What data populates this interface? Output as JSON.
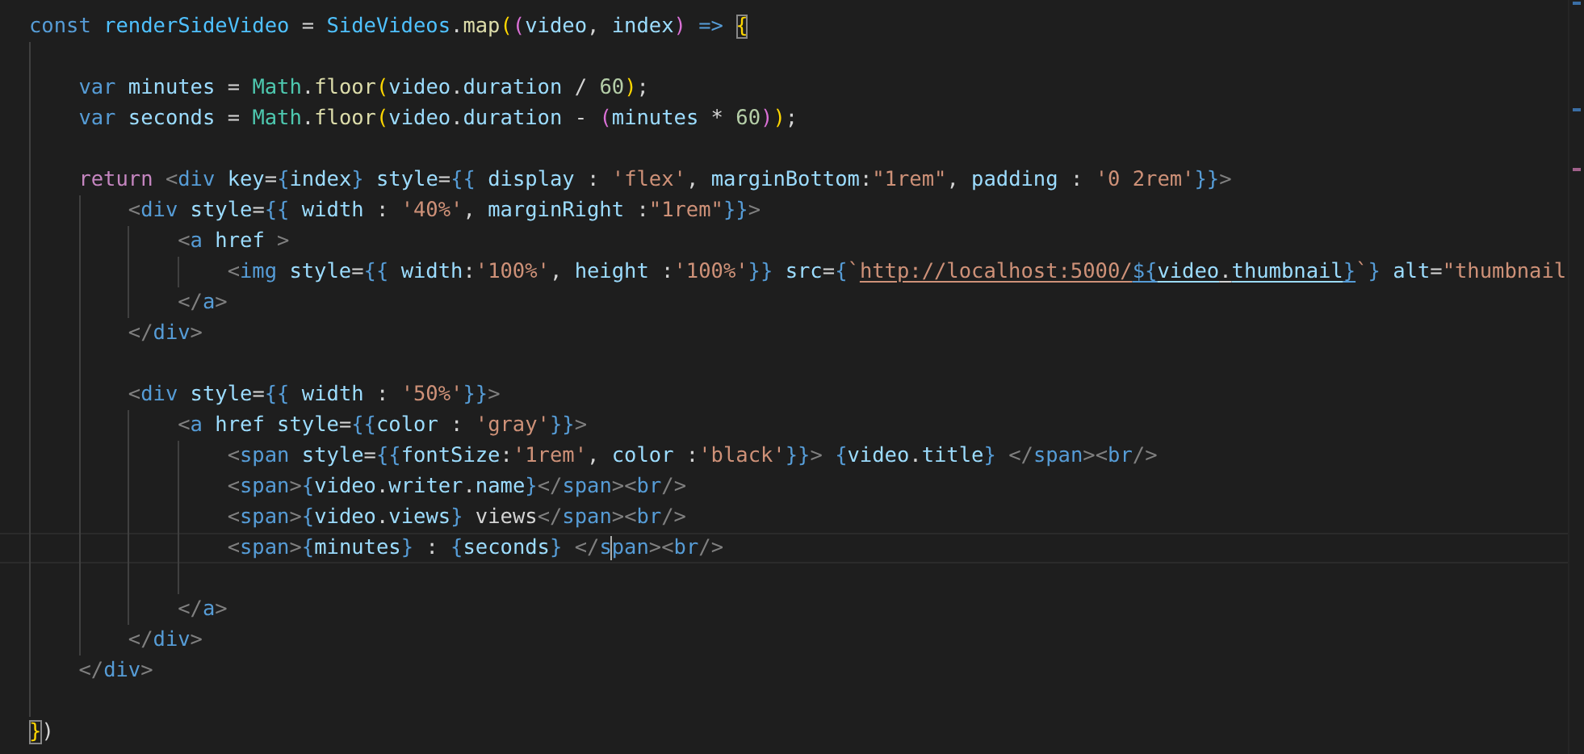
{
  "editor": {
    "lines": [
      {
        "current": false,
        "tokens": [
          {
            "text": "const",
            "kind": "keyword"
          },
          {
            "text": " renderSideVideo",
            "kind": "constant"
          },
          {
            "text": " = ",
            "kind": "plain"
          },
          {
            "text": "SideVideos",
            "kind": "constant"
          },
          {
            "text": ".",
            "kind": "plain"
          },
          {
            "text": "map",
            "kind": "function"
          },
          {
            "text": "(",
            "kind": "bracket1"
          },
          {
            "text": "(",
            "kind": "bracket2"
          },
          {
            "text": "video",
            "kind": "variable"
          },
          {
            "text": ", ",
            "kind": "plain"
          },
          {
            "text": "index",
            "kind": "variable"
          },
          {
            "text": ")",
            "kind": "bracket2"
          },
          {
            "text": " => ",
            "kind": "keyword"
          },
          {
            "text": "{",
            "kind": "bracket1",
            "matched": true
          }
        ]
      },
      {
        "current": false
      },
      {
        "current": false,
        "tokens": [
          {
            "text": "    var",
            "kind": "keyword"
          },
          {
            "text": " minutes",
            "kind": "variable"
          },
          {
            "text": " = ",
            "kind": "plain"
          },
          {
            "text": "Math",
            "kind": "class"
          },
          {
            "text": ".",
            "kind": "plain"
          },
          {
            "text": "floor",
            "kind": "function"
          },
          {
            "text": "(",
            "kind": "bracket1"
          },
          {
            "text": "video",
            "kind": "variable"
          },
          {
            "text": ".",
            "kind": "plain"
          },
          {
            "text": "duration",
            "kind": "variable"
          },
          {
            "text": " / ",
            "kind": "plain"
          },
          {
            "text": "60",
            "kind": "number"
          },
          {
            "text": ")",
            "kind": "bracket1"
          },
          {
            "text": ";",
            "kind": "plain"
          }
        ]
      },
      {
        "current": false,
        "tokens": [
          {
            "text": "    var",
            "kind": "keyword"
          },
          {
            "text": " seconds",
            "kind": "variable"
          },
          {
            "text": " = ",
            "kind": "plain"
          },
          {
            "text": "Math",
            "kind": "class"
          },
          {
            "text": ".",
            "kind": "plain"
          },
          {
            "text": "floor",
            "kind": "function"
          },
          {
            "text": "(",
            "kind": "bracket1"
          },
          {
            "text": "video",
            "kind": "variable"
          },
          {
            "text": ".",
            "kind": "plain"
          },
          {
            "text": "duration",
            "kind": "variable"
          },
          {
            "text": " - ",
            "kind": "plain"
          },
          {
            "text": "(",
            "kind": "bracket2"
          },
          {
            "text": "minutes",
            "kind": "variable"
          },
          {
            "text": " * ",
            "kind": "plain"
          },
          {
            "text": "60",
            "kind": "number"
          },
          {
            "text": ")",
            "kind": "bracket2"
          },
          {
            "text": ")",
            "kind": "bracket1"
          },
          {
            "text": ";",
            "kind": "plain"
          }
        ]
      },
      {
        "current": false
      },
      {
        "current": false,
        "tokens": [
          {
            "text": "    return",
            "kind": "control"
          },
          {
            "text": " <",
            "kind": "angle"
          },
          {
            "text": "div",
            "kind": "tag"
          },
          {
            "text": " key",
            "kind": "attribute"
          },
          {
            "text": "=",
            "kind": "plain"
          },
          {
            "text": "{",
            "kind": "brace"
          },
          {
            "text": "index",
            "kind": "variable"
          },
          {
            "text": "}",
            "kind": "brace"
          },
          {
            "text": " style",
            "kind": "attribute"
          },
          {
            "text": "=",
            "kind": "plain"
          },
          {
            "text": "{{",
            "kind": "brace"
          },
          {
            "text": " display",
            "kind": "variable"
          },
          {
            "text": " : ",
            "kind": "plain"
          },
          {
            "text": "'flex'",
            "kind": "string"
          },
          {
            "text": ", ",
            "kind": "plain"
          },
          {
            "text": "marginBottom",
            "kind": "variable"
          },
          {
            "text": ":",
            "kind": "plain"
          },
          {
            "text": "\"1rem\"",
            "kind": "string"
          },
          {
            "text": ", ",
            "kind": "plain"
          },
          {
            "text": "padding",
            "kind": "variable"
          },
          {
            "text": " : ",
            "kind": "plain"
          },
          {
            "text": "'0 2rem'",
            "kind": "string"
          },
          {
            "text": "}}",
            "kind": "brace"
          },
          {
            "text": ">",
            "kind": "angle"
          }
        ]
      },
      {
        "current": false,
        "tokens": [
          {
            "text": "        <",
            "kind": "angle"
          },
          {
            "text": "div",
            "kind": "tag"
          },
          {
            "text": " style",
            "kind": "attribute"
          },
          {
            "text": "=",
            "kind": "plain"
          },
          {
            "text": "{{",
            "kind": "brace"
          },
          {
            "text": " width",
            "kind": "variable"
          },
          {
            "text": " : ",
            "kind": "plain"
          },
          {
            "text": "'40%'",
            "kind": "string"
          },
          {
            "text": ", ",
            "kind": "plain"
          },
          {
            "text": "marginRight",
            "kind": "variable"
          },
          {
            "text": " :",
            "kind": "plain"
          },
          {
            "text": "\"1rem\"",
            "kind": "string"
          },
          {
            "text": "}}",
            "kind": "brace"
          },
          {
            "text": ">",
            "kind": "angle"
          }
        ]
      },
      {
        "current": false,
        "tokens": [
          {
            "text": "            <",
            "kind": "angle"
          },
          {
            "text": "a",
            "kind": "tag"
          },
          {
            "text": " href",
            "kind": "attribute"
          },
          {
            "text": " >",
            "kind": "angle"
          }
        ]
      },
      {
        "current": false,
        "tokens": [
          {
            "text": "                <",
            "kind": "angle"
          },
          {
            "text": "img",
            "kind": "tag"
          },
          {
            "text": " style",
            "kind": "attribute"
          },
          {
            "text": "=",
            "kind": "plain"
          },
          {
            "text": "{{",
            "kind": "brace"
          },
          {
            "text": " width",
            "kind": "variable"
          },
          {
            "text": ":",
            "kind": "plain"
          },
          {
            "text": "'100%'",
            "kind": "string"
          },
          {
            "text": ", ",
            "kind": "plain"
          },
          {
            "text": "height",
            "kind": "variable"
          },
          {
            "text": " :",
            "kind": "plain"
          },
          {
            "text": "'100%'",
            "kind": "string"
          },
          {
            "text": "}}",
            "kind": "brace"
          },
          {
            "text": " src",
            "kind": "attribute"
          },
          {
            "text": "=",
            "kind": "plain"
          },
          {
            "text": "{",
            "kind": "brace"
          },
          {
            "text": "`",
            "kind": "string"
          },
          {
            "text": "http://localhost:5000/",
            "kind": "string",
            "underlined": true
          },
          {
            "text": "${",
            "kind": "brace",
            "underlined": true
          },
          {
            "text": "video",
            "kind": "variable",
            "underlined": true
          },
          {
            "text": ".",
            "kind": "plain",
            "underlined": true
          },
          {
            "text": "thumbnail",
            "kind": "variable",
            "underlined": true
          },
          {
            "text": "}",
            "kind": "brace",
            "underlined": true
          },
          {
            "text": "`",
            "kind": "string"
          },
          {
            "text": "}",
            "kind": "brace"
          },
          {
            "text": " alt",
            "kind": "attribute"
          },
          {
            "text": "=",
            "kind": "plain"
          },
          {
            "text": "\"thumbnail",
            "kind": "string"
          }
        ]
      },
      {
        "current": false,
        "tokens": [
          {
            "text": "            </",
            "kind": "angle"
          },
          {
            "text": "a",
            "kind": "tag"
          },
          {
            "text": ">",
            "kind": "angle"
          }
        ]
      },
      {
        "current": false,
        "tokens": [
          {
            "text": "        </",
            "kind": "angle"
          },
          {
            "text": "div",
            "kind": "tag"
          },
          {
            "text": ">",
            "kind": "angle"
          }
        ]
      },
      {
        "current": false
      },
      {
        "current": false,
        "tokens": [
          {
            "text": "        <",
            "kind": "angle"
          },
          {
            "text": "div",
            "kind": "tag"
          },
          {
            "text": " style",
            "kind": "attribute"
          },
          {
            "text": "=",
            "kind": "plain"
          },
          {
            "text": "{{",
            "kind": "brace"
          },
          {
            "text": " width",
            "kind": "variable"
          },
          {
            "text": " : ",
            "kind": "plain"
          },
          {
            "text": "'50%'",
            "kind": "string"
          },
          {
            "text": "}}",
            "kind": "brace"
          },
          {
            "text": ">",
            "kind": "angle"
          }
        ]
      },
      {
        "current": false,
        "tokens": [
          {
            "text": "            <",
            "kind": "angle"
          },
          {
            "text": "a",
            "kind": "tag"
          },
          {
            "text": " href",
            "kind": "attribute"
          },
          {
            "text": " style",
            "kind": "attribute"
          },
          {
            "text": "=",
            "kind": "plain"
          },
          {
            "text": "{{",
            "kind": "brace"
          },
          {
            "text": "color",
            "kind": "variable"
          },
          {
            "text": " : ",
            "kind": "plain"
          },
          {
            "text": "'gray'",
            "kind": "string"
          },
          {
            "text": "}}",
            "kind": "brace"
          },
          {
            "text": ">",
            "kind": "angle"
          }
        ]
      },
      {
        "current": false,
        "tokens": [
          {
            "text": "                <",
            "kind": "angle"
          },
          {
            "text": "span",
            "kind": "tag"
          },
          {
            "text": " style",
            "kind": "attribute"
          },
          {
            "text": "=",
            "kind": "plain"
          },
          {
            "text": "{{",
            "kind": "brace"
          },
          {
            "text": "fontSize",
            "kind": "variable"
          },
          {
            "text": ":",
            "kind": "plain"
          },
          {
            "text": "'1rem'",
            "kind": "string"
          },
          {
            "text": ", ",
            "kind": "plain"
          },
          {
            "text": "color",
            "kind": "variable"
          },
          {
            "text": " :",
            "kind": "plain"
          },
          {
            "text": "'black'",
            "kind": "string"
          },
          {
            "text": "}}",
            "kind": "brace"
          },
          {
            "text": ">",
            "kind": "angle"
          },
          {
            "text": " {",
            "kind": "brace"
          },
          {
            "text": "video",
            "kind": "variable"
          },
          {
            "text": ".",
            "kind": "plain"
          },
          {
            "text": "title",
            "kind": "variable"
          },
          {
            "text": "}",
            "kind": "brace"
          },
          {
            "text": " </",
            "kind": "angle"
          },
          {
            "text": "span",
            "kind": "tag"
          },
          {
            "text": ">",
            "kind": "angle"
          },
          {
            "text": "<",
            "kind": "angle"
          },
          {
            "text": "br",
            "kind": "tag"
          },
          {
            "text": "/>",
            "kind": "angle"
          }
        ]
      },
      {
        "current": false,
        "tokens": [
          {
            "text": "                <",
            "kind": "angle"
          },
          {
            "text": "span",
            "kind": "tag"
          },
          {
            "text": ">",
            "kind": "angle"
          },
          {
            "text": "{",
            "kind": "brace"
          },
          {
            "text": "video",
            "kind": "variable"
          },
          {
            "text": ".",
            "kind": "plain"
          },
          {
            "text": "writer",
            "kind": "variable"
          },
          {
            "text": ".",
            "kind": "plain"
          },
          {
            "text": "name",
            "kind": "variable"
          },
          {
            "text": "}",
            "kind": "brace"
          },
          {
            "text": "</",
            "kind": "angle"
          },
          {
            "text": "span",
            "kind": "tag"
          },
          {
            "text": ">",
            "kind": "angle"
          },
          {
            "text": "<",
            "kind": "angle"
          },
          {
            "text": "br",
            "kind": "tag"
          },
          {
            "text": "/>",
            "kind": "angle"
          }
        ]
      },
      {
        "current": false,
        "tokens": [
          {
            "text": "                <",
            "kind": "angle"
          },
          {
            "text": "span",
            "kind": "tag"
          },
          {
            "text": ">",
            "kind": "angle"
          },
          {
            "text": "{",
            "kind": "brace"
          },
          {
            "text": "video",
            "kind": "variable"
          },
          {
            "text": ".",
            "kind": "plain"
          },
          {
            "text": "views",
            "kind": "variable"
          },
          {
            "text": "}",
            "kind": "brace"
          },
          {
            "text": " views",
            "kind": "plain"
          },
          {
            "text": "</",
            "kind": "angle"
          },
          {
            "text": "span",
            "kind": "tag"
          },
          {
            "text": ">",
            "kind": "angle"
          },
          {
            "text": "<",
            "kind": "angle"
          },
          {
            "text": "br",
            "kind": "tag"
          },
          {
            "text": "/>",
            "kind": "angle"
          }
        ]
      },
      {
        "current": true,
        "tokens": [
          {
            "text": "                <",
            "kind": "angle"
          },
          {
            "text": "span",
            "kind": "tag"
          },
          {
            "text": ">",
            "kind": "angle"
          },
          {
            "text": "{",
            "kind": "brace"
          },
          {
            "text": "minutes",
            "kind": "variable"
          },
          {
            "text": "}",
            "kind": "brace"
          },
          {
            "text": " : ",
            "kind": "plain"
          },
          {
            "text": "{",
            "kind": "brace"
          },
          {
            "text": "seconds",
            "kind": "variable"
          },
          {
            "text": "}",
            "kind": "brace"
          },
          {
            "text": " </",
            "kind": "angle"
          },
          {
            "text": "s",
            "kind": "tag"
          },
          {
            "text": "pan",
            "kind": "tag",
            "caret": true
          },
          {
            "text": ">",
            "kind": "angle"
          },
          {
            "text": "<",
            "kind": "angle"
          },
          {
            "text": "br",
            "kind": "tag"
          },
          {
            "text": "/>",
            "kind": "angle"
          }
        ]
      },
      {
        "current": false
      },
      {
        "current": false,
        "tokens": [
          {
            "text": "            </",
            "kind": "angle"
          },
          {
            "text": "a",
            "kind": "tag"
          },
          {
            "text": ">",
            "kind": "angle"
          }
        ]
      },
      {
        "current": false,
        "tokens": [
          {
            "text": "        </",
            "kind": "angle"
          },
          {
            "text": "div",
            "kind": "tag"
          },
          {
            "text": ">",
            "kind": "angle"
          }
        ]
      },
      {
        "current": false,
        "tokens": [
          {
            "text": "    </",
            "kind": "angle"
          },
          {
            "text": "div",
            "kind": "tag"
          },
          {
            "text": ">",
            "kind": "angle"
          }
        ]
      },
      {
        "current": false
      },
      {
        "current": false,
        "tokens": [
          {
            "text": "}",
            "kind": "bracket1",
            "matched": true
          },
          {
            "text": ")",
            "kind": "plain"
          }
        ]
      }
    ]
  }
}
